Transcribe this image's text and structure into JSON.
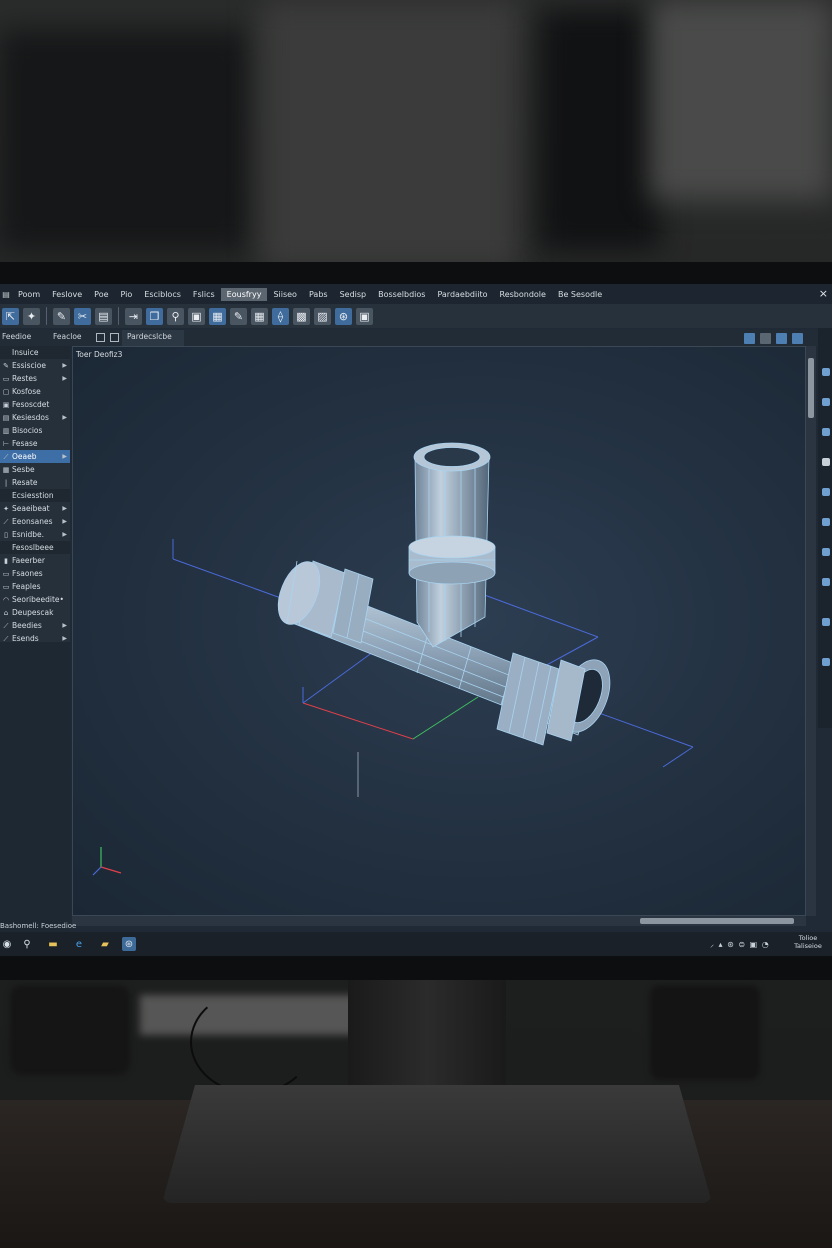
{
  "app": {
    "menu": [
      "Poom",
      "Feslove",
      "Poe",
      "Pio",
      "Esciblocs",
      "Fslics",
      "Eousfryy",
      "Siiseo",
      "Pabs",
      "Sedisp",
      "Bosselbdios",
      "Pardaebdiito",
      "Resbondole",
      "Be Sesodle"
    ],
    "active_menu_index": 6,
    "close_label": "×"
  },
  "toolbar": {
    "icons": [
      "new-file-icon",
      "puzzle-icon",
      "pen-icon",
      "scissors-icon",
      "document-icon",
      "export-icon",
      "copy-icon",
      "search-icon",
      "image-icon",
      "layers-icon",
      "brush-icon",
      "grid-icon",
      "connect-icon",
      "mesh-icon",
      "box-icon",
      "globe-icon",
      "window-icon"
    ]
  },
  "tabs": {
    "left_label": "Feedioe",
    "second_label": "Feacloe",
    "current_label": "Pardecslcbe"
  },
  "left_panel": {
    "items": [
      {
        "label": "Insuice",
        "icon": "",
        "arrow": false,
        "head": true
      },
      {
        "label": "Essiscioe",
        "icon": "✎",
        "arrow": true
      },
      {
        "label": "Restes",
        "icon": "▭",
        "arrow": true
      },
      {
        "label": "Kosfose",
        "icon": "▢",
        "arrow": false
      },
      {
        "label": "Fesoscdet",
        "icon": "▣",
        "arrow": false
      },
      {
        "label": "Kesiesdos",
        "icon": "▤",
        "arrow": true
      },
      {
        "label": "Bisocios",
        "icon": "▥",
        "arrow": false
      },
      {
        "label": "Fesase",
        "icon": "⊢",
        "arrow": false
      },
      {
        "label": "Oeaeb",
        "icon": "⟋",
        "arrow": true,
        "selected": true
      },
      {
        "label": "Sesbe",
        "icon": "▦",
        "arrow": false
      },
      {
        "label": "Resate",
        "icon": "|",
        "arrow": false
      },
      {
        "label": "Ecsiesstion",
        "icon": "",
        "arrow": false,
        "head": true
      },
      {
        "label": "Seaeibeat",
        "icon": "✦",
        "arrow": true
      },
      {
        "label": "Eeonsanes",
        "icon": "⟋",
        "arrow": true
      },
      {
        "label": "Esnidbe.",
        "icon": "▯",
        "arrow": true
      },
      {
        "label": "Fesoslbeee",
        "icon": "",
        "arrow": false,
        "head": true
      },
      {
        "label": "Faeerber",
        "icon": "▮",
        "arrow": false
      },
      {
        "label": "Fsaones",
        "icon": "▭",
        "arrow": false
      },
      {
        "label": "Feaples",
        "icon": "▭",
        "arrow": false
      },
      {
        "label": "Seoribeedite",
        "icon": "◠",
        "arrow": false,
        "dot": true
      },
      {
        "label": "Deupescak",
        "icon": "⌂",
        "arrow": false
      },
      {
        "label": "Beedies",
        "icon": "⟋",
        "arrow": true
      },
      {
        "label": "Esends",
        "icon": "⟋",
        "arrow": true
      }
    ]
  },
  "viewport": {
    "label": "Toer Deofiz3"
  },
  "status": {
    "text": "Bashomell: Foesedioe"
  },
  "taskbar": {
    "icons": [
      "chrome-icon",
      "search-icon",
      "folder-icon",
      "edge-icon",
      "explorer-icon",
      "app-icon"
    ],
    "tray_text": "⸝ ▴ ⊛ ⊜ ▣ ◔",
    "clock_line1": "Tolioe",
    "clock_line2": "Taliseioe"
  },
  "colors": {
    "accent": "#3d6ea6",
    "wire": "#a9d3f0",
    "axis_x": "#e0404a",
    "axis_y": "#40c060",
    "axis_z": "#4a6ad8"
  }
}
